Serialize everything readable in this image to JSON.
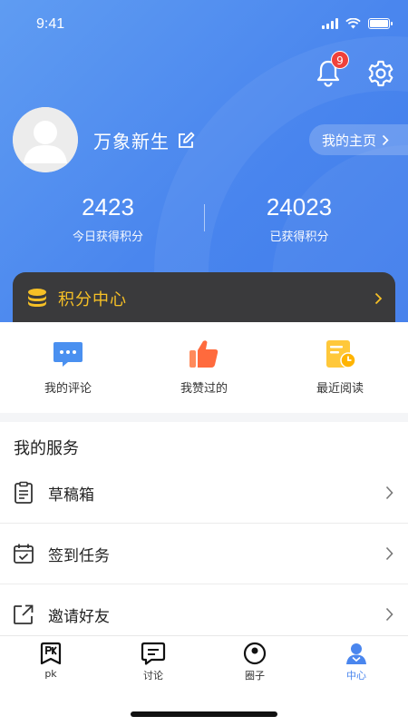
{
  "status_bar": {
    "time": "9:41"
  },
  "header": {
    "notification_count": "9"
  },
  "profile": {
    "username": "万象新生",
    "homepage_label": "我的主页"
  },
  "stats": [
    {
      "value": "2423",
      "label": "今日获得积分"
    },
    {
      "value": "24023",
      "label": "已获得积分"
    }
  ],
  "points_center": {
    "label": "积分中心"
  },
  "shortcuts": [
    {
      "label": "我的评论",
      "icon": "comment-icon"
    },
    {
      "label": "我赞过的",
      "icon": "thumbs-up-icon"
    },
    {
      "label": "最近阅读",
      "icon": "recent-reading-icon"
    }
  ],
  "services": {
    "title": "我的服务",
    "items": [
      {
        "label": "草稿箱",
        "icon": "drafts-icon"
      },
      {
        "label": "签到任务",
        "icon": "calendar-check-icon"
      },
      {
        "label": "邀请好友",
        "icon": "share-icon"
      }
    ]
  },
  "tabbar": {
    "items": [
      {
        "label": "pk",
        "icon": "pk-icon"
      },
      {
        "label": "讨论",
        "icon": "discussion-icon"
      },
      {
        "label": "圈子",
        "icon": "circle-icon"
      },
      {
        "label": "中心",
        "icon": "user-center-icon"
      }
    ],
    "active": "中心"
  },
  "colors": {
    "primary": "#4a86ee",
    "accent_gold": "#f6c026",
    "dark_card": "#3a3a3c",
    "badge": "#f0413b"
  }
}
